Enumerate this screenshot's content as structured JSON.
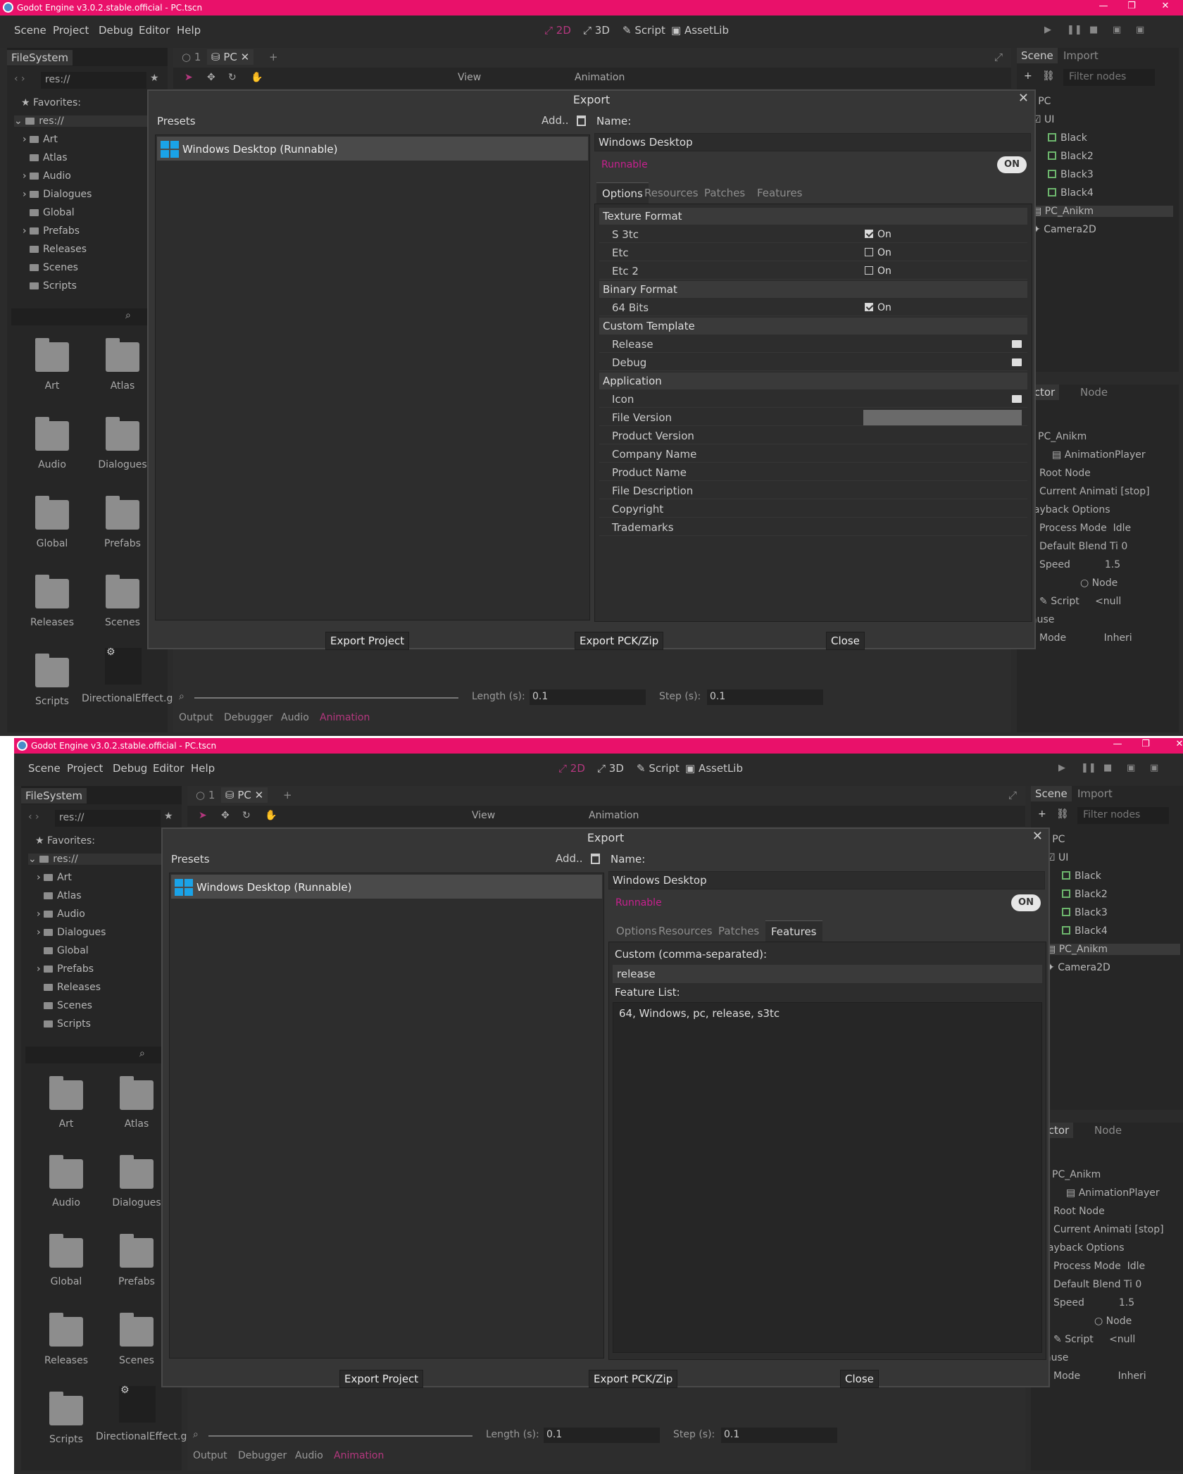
{
  "app": {
    "window_title": "Godot Engine v3.0.2.stable.official - PC.tscn",
    "accent": "#e9116a",
    "purple": "#b4377e"
  },
  "menu": [
    "Scene",
    "Project",
    "Debug",
    "Editor",
    "Help"
  ],
  "workspaces": [
    "2D",
    "3D",
    "Script",
    "AssetLib"
  ],
  "filesystem": {
    "tab": "FileSystem",
    "path": "res://",
    "favorites": "Favorites:",
    "root": "res://",
    "folders": [
      "Art",
      "Atlas",
      "Audio",
      "Dialogues",
      "Global",
      "Prefabs",
      "Releases",
      "Scenes",
      "Scripts"
    ],
    "grid": [
      "Art",
      "Atlas",
      "Audio",
      "Dialogues",
      "Global",
      "Prefabs",
      "Releases",
      "Scenes",
      "Scripts",
      "DirectionalEffect.gd"
    ]
  },
  "editor_tabs": [
    "1",
    "PC"
  ],
  "toolbar": {
    "view": "View",
    "animation": "Animation"
  },
  "scene_panel": {
    "tabs": [
      "Scene",
      "Import"
    ],
    "filter_placeholder": "Filter nodes",
    "nodes": [
      "PC",
      "UI",
      "Black",
      "Black2",
      "Black3",
      "Black4",
      "PC_Anikm",
      "Camera2D"
    ]
  },
  "inspector": {
    "tabs": [
      "pector",
      "Node"
    ],
    "node_path": "PC_Anikm",
    "class": "AnimationPlayer",
    "props": [
      {
        "name": "Root Node",
        "value": ".."
      },
      {
        "name": "Current Animati",
        "value": "[stop]"
      },
      {
        "name": "layback Options",
        "value": ""
      },
      {
        "name": "Process Mode",
        "value": "Idle"
      },
      {
        "name": "Default Blend Ti",
        "value": "0"
      },
      {
        "name": "Speed",
        "value": "1.5"
      },
      {
        "name": "Node",
        "value": ""
      },
      {
        "name": "Script",
        "value": "<null"
      },
      {
        "name": "ause",
        "value": ""
      },
      {
        "name": "Mode",
        "value": "Inheri"
      }
    ]
  },
  "bottom": {
    "length_label": "Length (s):",
    "length_value": "0.1",
    "step_label": "Step (s):",
    "step_value": "0.1",
    "tabs": [
      "Output",
      "Debugger",
      "Audio",
      "Animation"
    ]
  },
  "export_dialog": {
    "title": "Export",
    "presets_label": "Presets",
    "add_label": "Add..",
    "name_label": "Name:",
    "preset_item": "Windows Desktop (Runnable)",
    "name_value": "Windows Desktop",
    "runnable": "Runnable",
    "toggle": "ON",
    "tabs": [
      "Options",
      "Resources",
      "Patches",
      "Features"
    ],
    "options": {
      "texture_format": "Texture Format",
      "s3tc": "S 3tc",
      "etc": "Etc",
      "etc2": "Etc 2",
      "binary_format": "Binary Format",
      "bits64": "64 Bits",
      "on_text": "On",
      "custom_template": "Custom Template",
      "release": "Release",
      "debug": "Debug",
      "application": "Application",
      "app_props": [
        "Icon",
        "File Version",
        "Product Version",
        "Company Name",
        "Product Name",
        "File Description",
        "Copyright",
        "Trademarks"
      ]
    },
    "features": {
      "custom_label": "Custom (comma-separated):",
      "custom_value": "release",
      "list_label": "Feature List:",
      "list_value": "64, Windows, pc, release, s3tc"
    },
    "buttons": {
      "export_project": "Export Project",
      "export_pck": "Export PCK/Zip",
      "close": "Close"
    }
  }
}
